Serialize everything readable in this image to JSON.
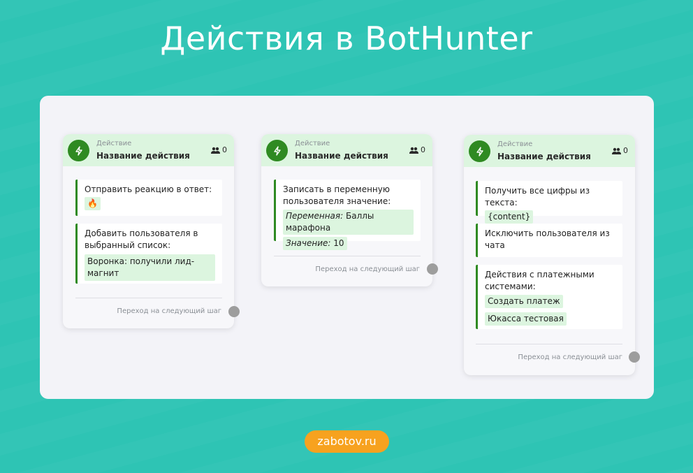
{
  "title": "Действия в BotHunter",
  "site": "zabotov.ru",
  "colors": {
    "background": "#2ec4b4",
    "accent_green": "#2f8a22",
    "header_green": "#dcf5df",
    "badge_orange": "#f7a21f"
  },
  "cards": [
    {
      "header_small": "Действие",
      "header_name": "Название действия",
      "users_count": "0",
      "actions": [
        {
          "label": "Отправить реакцию в ответ:",
          "tag": "🔥"
        },
        {
          "label": "Добавить пользователя в выбранный список:",
          "tag": "Воронка: получили лид-магнит"
        }
      ],
      "next_label": "Переход на следующий шаг"
    },
    {
      "header_small": "Действие",
      "header_name": "Название действия",
      "users_count": "0",
      "actions": [
        {
          "label": "Записать в переменную пользователя значение:",
          "var_key": "Переменная:",
          "var_value": "Баллы марафона",
          "val_key": "Значение:",
          "val_value": "10"
        }
      ],
      "next_label": "Переход на следующий шаг"
    },
    {
      "header_small": "Действие",
      "header_name": "Название действия",
      "users_count": "0",
      "actions": [
        {
          "label": "Получить все цифры из текста:",
          "tag": "{content}"
        },
        {
          "label": "Исключить пользователя из чата"
        },
        {
          "label": "Действия с платежными системами:",
          "tag1": "Создать платеж",
          "tag2": "Юкасса тестовая"
        }
      ],
      "next_label": "Переход на следующий шаг"
    }
  ]
}
